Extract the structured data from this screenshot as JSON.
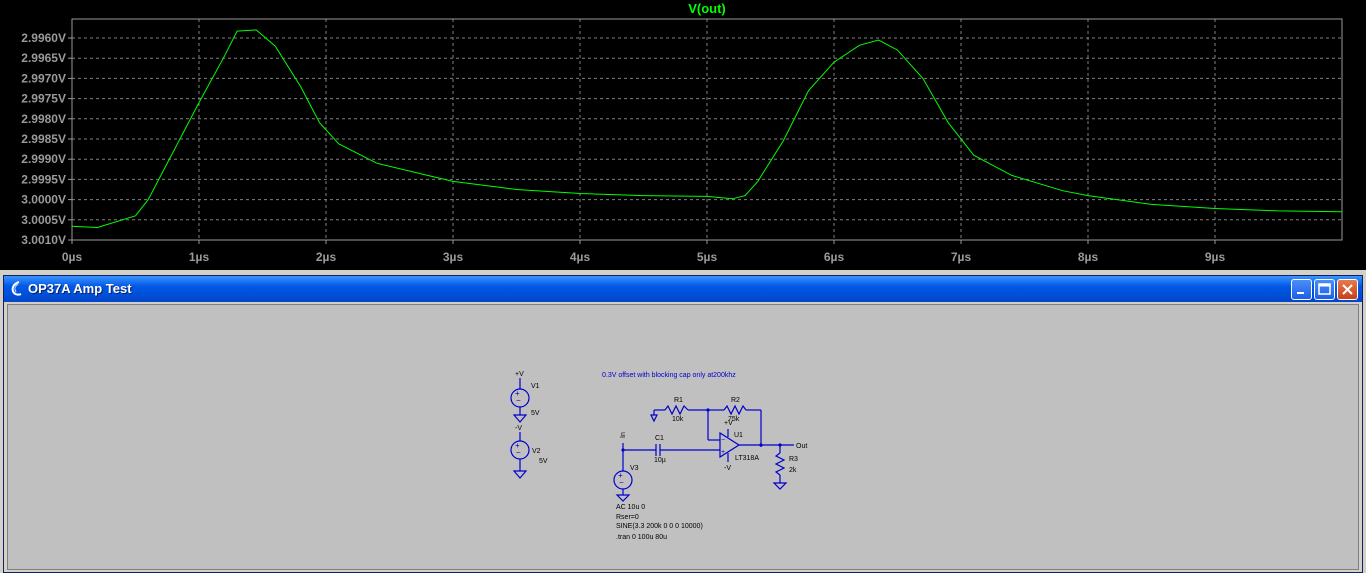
{
  "plot": {
    "title": "V(out)",
    "y_ticks": [
      "2.9960V",
      "2.9965V",
      "2.9970V",
      "2.9975V",
      "2.9980V",
      "2.9985V",
      "2.9990V",
      "2.9995V",
      "3.0000V",
      "3.0005V",
      "3.0010V"
    ],
    "x_ticks": [
      "0µs",
      "1µs",
      "2µs",
      "3µs",
      "4µs",
      "5µs",
      "6µs",
      "7µs",
      "8µs",
      "9µs"
    ]
  },
  "chart_data": {
    "type": "line",
    "title": "V(out)",
    "xlabel": "",
    "ylabel": "",
    "xlim": [
      0,
      10
    ],
    "ylim_values": [
      -3.001,
      -2.99555
    ],
    "grid": true,
    "series": [
      {
        "name": "V(out)",
        "color": "#00ff00",
        "x": [
          0,
          0.2,
          0.5,
          0.6,
          0.8,
          1.0,
          1.2,
          1.3,
          1.45,
          1.6,
          1.8,
          1.95,
          2.1,
          2.4,
          2.8,
          3.0,
          3.5,
          4.0,
          4.5,
          5.0,
          5.2,
          5.3,
          5.4,
          5.6,
          5.8,
          6.0,
          6.2,
          6.35,
          6.5,
          6.7,
          6.9,
          7.1,
          7.4,
          7.8,
          8.0,
          8.5,
          9.0,
          9.5,
          10.0
        ],
        "y": [
          -3.00066,
          -3.00069,
          -3.0004,
          -3.0,
          -2.9988,
          -2.9976,
          -2.99645,
          -2.99583,
          -2.9958,
          -2.9962,
          -2.9972,
          -2.9981,
          -2.99862,
          -2.9991,
          -2.9994,
          -2.99955,
          -2.99975,
          -2.99985,
          -2.9999,
          -2.99992,
          -2.99998,
          -2.9999,
          -2.99955,
          -2.99855,
          -2.9973,
          -2.9966,
          -2.99618,
          -2.99605,
          -2.9963,
          -2.997,
          -2.9981,
          -2.9989,
          -2.9994,
          -2.99978,
          -2.9999,
          -3.00012,
          -3.00022,
          -3.00028,
          -3.0003
        ]
      }
    ],
    "y_tick_labels": [
      "2.9960V",
      "2.9965V",
      "2.9970V",
      "2.9975V",
      "2.9980V",
      "2.9985V",
      "2.9990V",
      "2.9995V",
      "3.0000V",
      "3.0005V",
      "3.0010V"
    ],
    "x_tick_labels": [
      "0µs",
      "1µs",
      "2µs",
      "3µs",
      "4µs",
      "5µs",
      "6µs",
      "7µs",
      "8µs",
      "9µs"
    ]
  },
  "window": {
    "title": "OP37A Amp Test"
  },
  "schematic": {
    "comment": "0.3V offset with blocking cap only at200khz",
    "v1": {
      "name": "V1",
      "value": "5V",
      "node": "+V"
    },
    "v2": {
      "name": "V2",
      "value": "5V",
      "node": "-V"
    },
    "v3": {
      "name": "V3"
    },
    "r1": {
      "name": "R1",
      "value": "10k"
    },
    "r2": {
      "name": "R2",
      "value": "75k"
    },
    "r3": {
      "name": "R3",
      "value": "2k"
    },
    "c1": {
      "name": "C1",
      "value": "10µ"
    },
    "u1": {
      "name": "U1",
      "part": "LT318A"
    },
    "in_label": "In",
    "out_label": "Out",
    "pos_label": "+V",
    "neg_label": "-V",
    "spice": [
      "AC 10u 0",
      "Rser=0",
      "SINE(3.3 200k 0 0 0 10000)",
      ".tran 0 100u 80u"
    ]
  },
  "colors": {
    "trace": "#00ff00",
    "grid": "#808080",
    "wire": "#0000cc",
    "canvas": "#c0c0c0",
    "titlebar": "#0050d8"
  }
}
